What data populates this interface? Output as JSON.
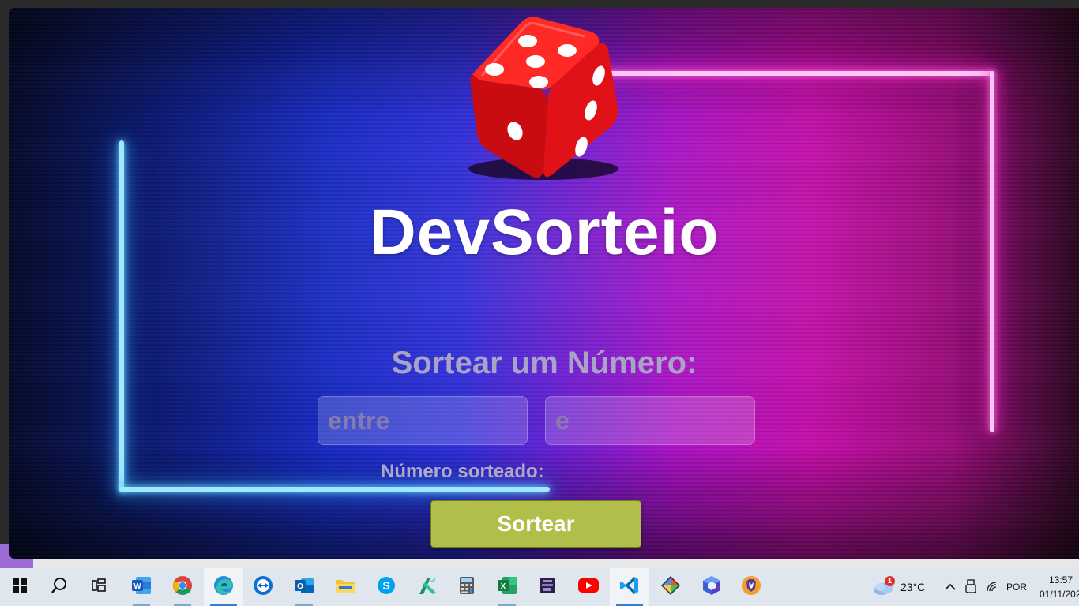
{
  "app": {
    "title": "DevSorteio",
    "subtitle": "Sortear um Número:",
    "input_from_placeholder": "entre",
    "input_to_placeholder": "e",
    "result_label": "Número sorteado:",
    "draw_button_label": "Sortear"
  },
  "taskbar": {
    "items": [
      {
        "name": "start",
        "icon": "windows-logo-icon"
      },
      {
        "name": "search",
        "icon": "search-icon"
      },
      {
        "name": "task-view",
        "icon": "task-view-icon"
      },
      {
        "name": "word",
        "icon": "word-icon"
      },
      {
        "name": "chrome",
        "icon": "chrome-icon"
      },
      {
        "name": "edge",
        "icon": "edge-icon"
      },
      {
        "name": "teamviewer",
        "icon": "teamviewer-icon"
      },
      {
        "name": "outlook",
        "icon": "outlook-icon"
      },
      {
        "name": "file-explorer",
        "icon": "folder-icon"
      },
      {
        "name": "skype",
        "icon": "skype-icon"
      },
      {
        "name": "app-green",
        "icon": "xamarin-icon"
      },
      {
        "name": "calculator",
        "icon": "calculator-icon"
      },
      {
        "name": "excel",
        "icon": "excel-icon"
      },
      {
        "name": "app-purple",
        "icon": "app-icon"
      },
      {
        "name": "youtube",
        "icon": "youtube-icon"
      },
      {
        "name": "vscode",
        "icon": "vscode-icon"
      },
      {
        "name": "git",
        "icon": "git-icon"
      },
      {
        "name": "app-blue",
        "icon": "power-automate-icon"
      },
      {
        "name": "brave",
        "icon": "brave-icon"
      }
    ],
    "weather_badge": "1",
    "temperature": "23°C",
    "language": "POR",
    "time": "13:57",
    "date": "01/11/202"
  },
  "colors": {
    "button_bg": "#b1bf4a",
    "neon_blue": "#9fe8ff",
    "neon_pink": "#ffc8f4",
    "dice_red": "#e8141a"
  }
}
